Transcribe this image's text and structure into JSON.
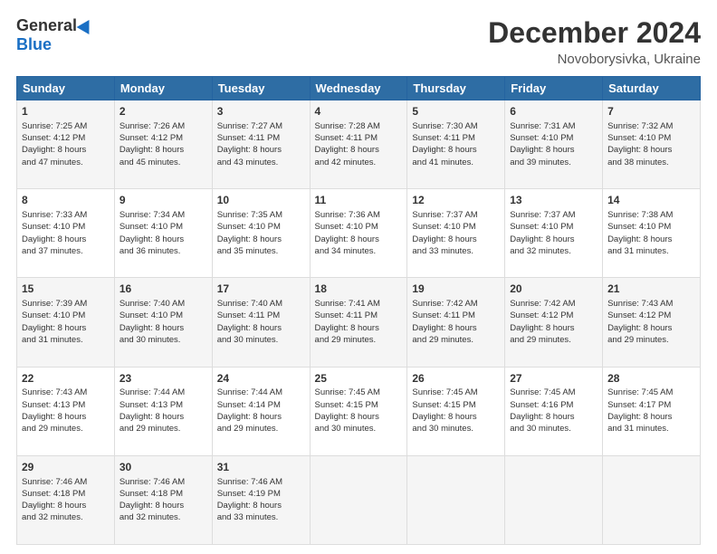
{
  "header": {
    "logo_general": "General",
    "logo_blue": "Blue",
    "month": "December 2024",
    "location": "Novoborysivka, Ukraine"
  },
  "days_of_week": [
    "Sunday",
    "Monday",
    "Tuesday",
    "Wednesday",
    "Thursday",
    "Friday",
    "Saturday"
  ],
  "weeks": [
    [
      {
        "day": 1,
        "lines": [
          "Sunrise: 7:25 AM",
          "Sunset: 4:12 PM",
          "Daylight: 8 hours",
          "and 47 minutes."
        ]
      },
      {
        "day": 2,
        "lines": [
          "Sunrise: 7:26 AM",
          "Sunset: 4:12 PM",
          "Daylight: 8 hours",
          "and 45 minutes."
        ]
      },
      {
        "day": 3,
        "lines": [
          "Sunrise: 7:27 AM",
          "Sunset: 4:11 PM",
          "Daylight: 8 hours",
          "and 43 minutes."
        ]
      },
      {
        "day": 4,
        "lines": [
          "Sunrise: 7:28 AM",
          "Sunset: 4:11 PM",
          "Daylight: 8 hours",
          "and 42 minutes."
        ]
      },
      {
        "day": 5,
        "lines": [
          "Sunrise: 7:30 AM",
          "Sunset: 4:11 PM",
          "Daylight: 8 hours",
          "and 41 minutes."
        ]
      },
      {
        "day": 6,
        "lines": [
          "Sunrise: 7:31 AM",
          "Sunset: 4:10 PM",
          "Daylight: 8 hours",
          "and 39 minutes."
        ]
      },
      {
        "day": 7,
        "lines": [
          "Sunrise: 7:32 AM",
          "Sunset: 4:10 PM",
          "Daylight: 8 hours",
          "and 38 minutes."
        ]
      }
    ],
    [
      {
        "day": 8,
        "lines": [
          "Sunrise: 7:33 AM",
          "Sunset: 4:10 PM",
          "Daylight: 8 hours",
          "and 37 minutes."
        ]
      },
      {
        "day": 9,
        "lines": [
          "Sunrise: 7:34 AM",
          "Sunset: 4:10 PM",
          "Daylight: 8 hours",
          "and 36 minutes."
        ]
      },
      {
        "day": 10,
        "lines": [
          "Sunrise: 7:35 AM",
          "Sunset: 4:10 PM",
          "Daylight: 8 hours",
          "and 35 minutes."
        ]
      },
      {
        "day": 11,
        "lines": [
          "Sunrise: 7:36 AM",
          "Sunset: 4:10 PM",
          "Daylight: 8 hours",
          "and 34 minutes."
        ]
      },
      {
        "day": 12,
        "lines": [
          "Sunrise: 7:37 AM",
          "Sunset: 4:10 PM",
          "Daylight: 8 hours",
          "and 33 minutes."
        ]
      },
      {
        "day": 13,
        "lines": [
          "Sunrise: 7:37 AM",
          "Sunset: 4:10 PM",
          "Daylight: 8 hours",
          "and 32 minutes."
        ]
      },
      {
        "day": 14,
        "lines": [
          "Sunrise: 7:38 AM",
          "Sunset: 4:10 PM",
          "Daylight: 8 hours",
          "and 31 minutes."
        ]
      }
    ],
    [
      {
        "day": 15,
        "lines": [
          "Sunrise: 7:39 AM",
          "Sunset: 4:10 PM",
          "Daylight: 8 hours",
          "and 31 minutes."
        ]
      },
      {
        "day": 16,
        "lines": [
          "Sunrise: 7:40 AM",
          "Sunset: 4:10 PM",
          "Daylight: 8 hours",
          "and 30 minutes."
        ]
      },
      {
        "day": 17,
        "lines": [
          "Sunrise: 7:40 AM",
          "Sunset: 4:11 PM",
          "Daylight: 8 hours",
          "and 30 minutes."
        ]
      },
      {
        "day": 18,
        "lines": [
          "Sunrise: 7:41 AM",
          "Sunset: 4:11 PM",
          "Daylight: 8 hours",
          "and 29 minutes."
        ]
      },
      {
        "day": 19,
        "lines": [
          "Sunrise: 7:42 AM",
          "Sunset: 4:11 PM",
          "Daylight: 8 hours",
          "and 29 minutes."
        ]
      },
      {
        "day": 20,
        "lines": [
          "Sunrise: 7:42 AM",
          "Sunset: 4:12 PM",
          "Daylight: 8 hours",
          "and 29 minutes."
        ]
      },
      {
        "day": 21,
        "lines": [
          "Sunrise: 7:43 AM",
          "Sunset: 4:12 PM",
          "Daylight: 8 hours",
          "and 29 minutes."
        ]
      }
    ],
    [
      {
        "day": 22,
        "lines": [
          "Sunrise: 7:43 AM",
          "Sunset: 4:13 PM",
          "Daylight: 8 hours",
          "and 29 minutes."
        ]
      },
      {
        "day": 23,
        "lines": [
          "Sunrise: 7:44 AM",
          "Sunset: 4:13 PM",
          "Daylight: 8 hours",
          "and 29 minutes."
        ]
      },
      {
        "day": 24,
        "lines": [
          "Sunrise: 7:44 AM",
          "Sunset: 4:14 PM",
          "Daylight: 8 hours",
          "and 29 minutes."
        ]
      },
      {
        "day": 25,
        "lines": [
          "Sunrise: 7:45 AM",
          "Sunset: 4:15 PM",
          "Daylight: 8 hours",
          "and 30 minutes."
        ]
      },
      {
        "day": 26,
        "lines": [
          "Sunrise: 7:45 AM",
          "Sunset: 4:15 PM",
          "Daylight: 8 hours",
          "and 30 minutes."
        ]
      },
      {
        "day": 27,
        "lines": [
          "Sunrise: 7:45 AM",
          "Sunset: 4:16 PM",
          "Daylight: 8 hours",
          "and 30 minutes."
        ]
      },
      {
        "day": 28,
        "lines": [
          "Sunrise: 7:45 AM",
          "Sunset: 4:17 PM",
          "Daylight: 8 hours",
          "and 31 minutes."
        ]
      }
    ],
    [
      {
        "day": 29,
        "lines": [
          "Sunrise: 7:46 AM",
          "Sunset: 4:18 PM",
          "Daylight: 8 hours",
          "and 32 minutes."
        ]
      },
      {
        "day": 30,
        "lines": [
          "Sunrise: 7:46 AM",
          "Sunset: 4:18 PM",
          "Daylight: 8 hours",
          "and 32 minutes."
        ]
      },
      {
        "day": 31,
        "lines": [
          "Sunrise: 7:46 AM",
          "Sunset: 4:19 PM",
          "Daylight: 8 hours",
          "and 33 minutes."
        ]
      },
      null,
      null,
      null,
      null
    ]
  ]
}
